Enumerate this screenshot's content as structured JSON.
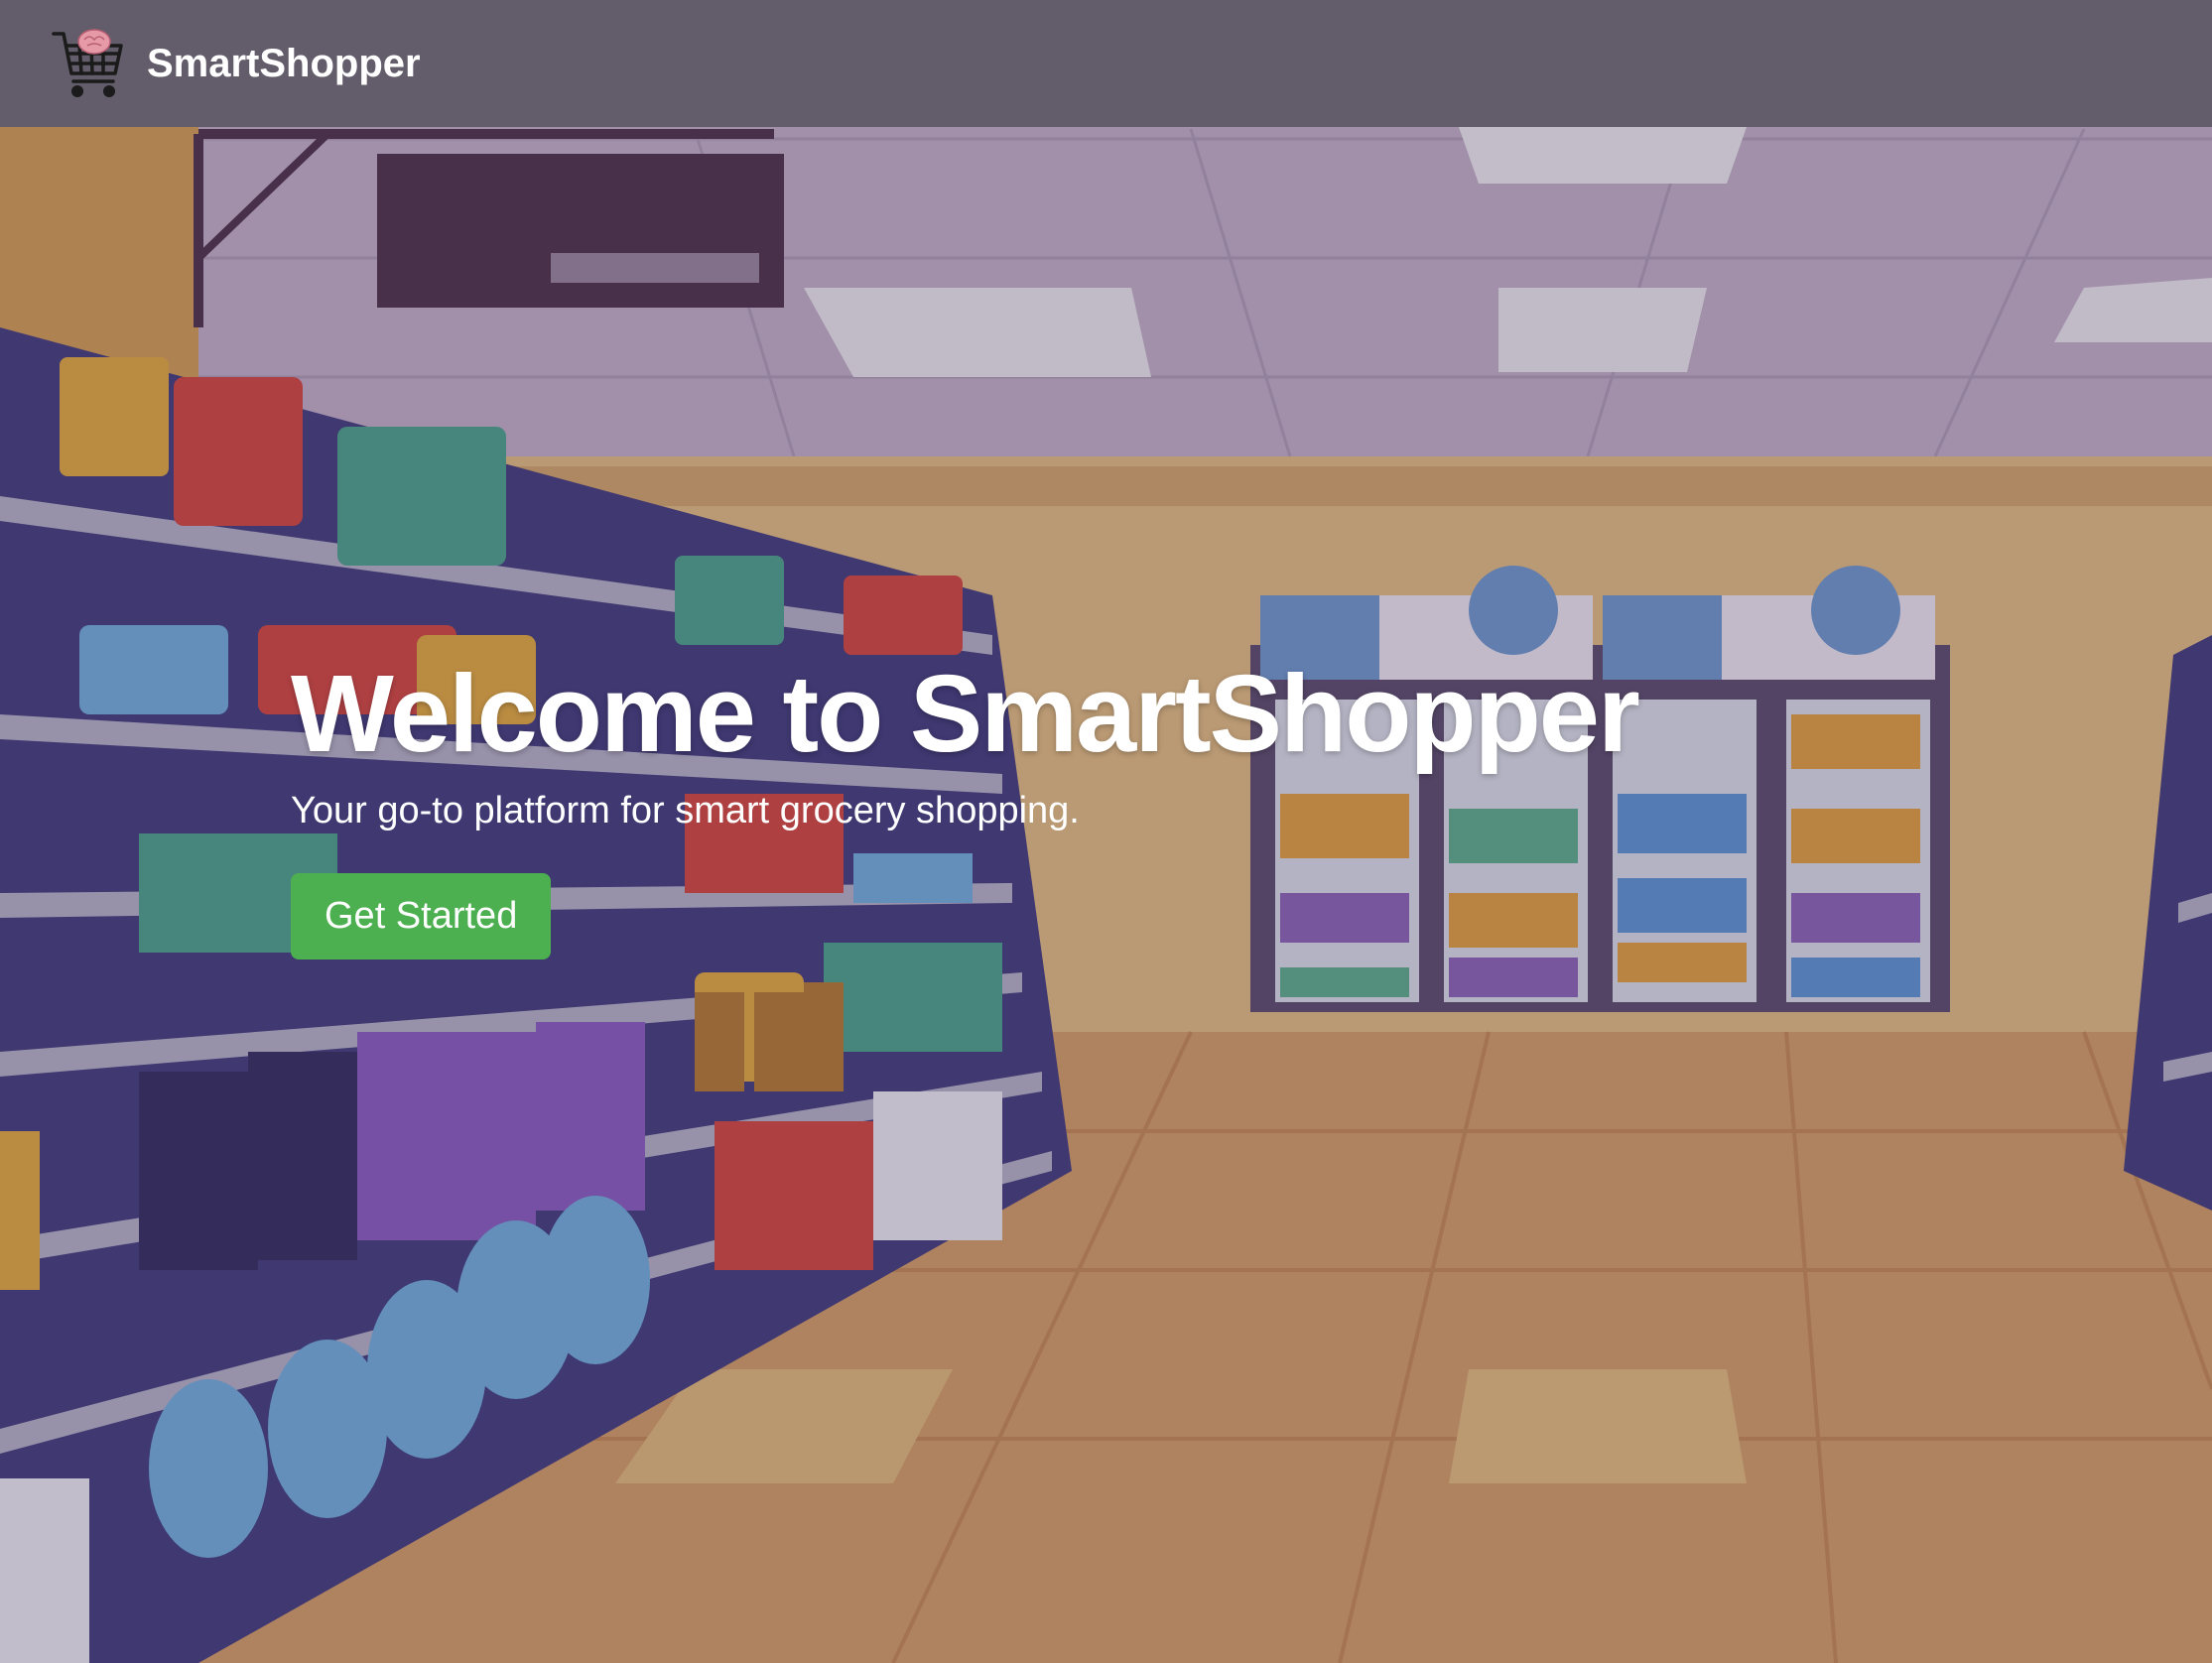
{
  "header": {
    "brand_name": "SmartShopper",
    "logo_icon": "shopping-cart-brain-icon"
  },
  "hero": {
    "title": "Welcome to SmartShopper",
    "subtitle": "Your go-to platform for smart grocery shopping.",
    "cta_label": "Get Started"
  },
  "colors": {
    "cta_background": "#4caf50",
    "navbar_background": "#55505c",
    "text": "#ffffff"
  },
  "background": {
    "subject": "supermarket-aisle-illustration"
  }
}
